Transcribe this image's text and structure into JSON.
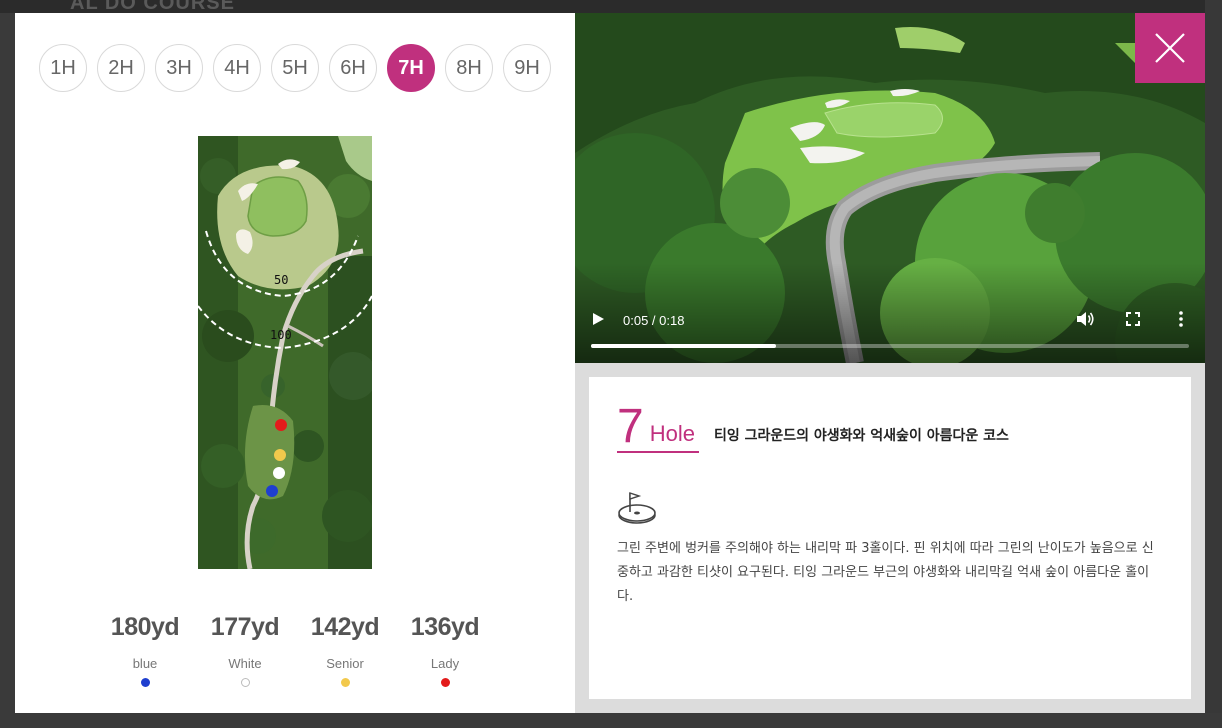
{
  "backdrop": {
    "partial_text": "AL DO COURSE"
  },
  "holes": {
    "tabs": [
      "1H",
      "2H",
      "3H",
      "4H",
      "5H",
      "6H",
      "7H",
      "8H",
      "9H"
    ],
    "active_index": 6
  },
  "map": {
    "distance_labels": [
      "50",
      "100"
    ]
  },
  "tees": [
    {
      "yardage": "180yd",
      "label": "blue",
      "color": "#1f3fcf"
    },
    {
      "yardage": "177yd",
      "label": "White",
      "color": "#ffffff"
    },
    {
      "yardage": "142yd",
      "label": "Senior",
      "color": "#f2c94c"
    },
    {
      "yardage": "136yd",
      "label": "Lady",
      "color": "#e31b1b"
    }
  ],
  "video": {
    "time": "0:05 / 0:18",
    "progress": 0.31
  },
  "info": {
    "hole_number": "7",
    "hole_word": "Hole",
    "title": "티잉 그라운드의 야생화와 억새숲이 아름다운 코스",
    "description": "그린 주변에 벙커를 주의해야 하는 내리막 파 3홀이다. 핀 위치에 따라 그린의 난이도가 높음으로 신중하고 과감한 티샷이 요구된다. 티잉 그라운드 부근의 야생화와 내리막길 억새 숲이 아름다운 홀이다."
  },
  "colors": {
    "accent": "#c0307e"
  }
}
